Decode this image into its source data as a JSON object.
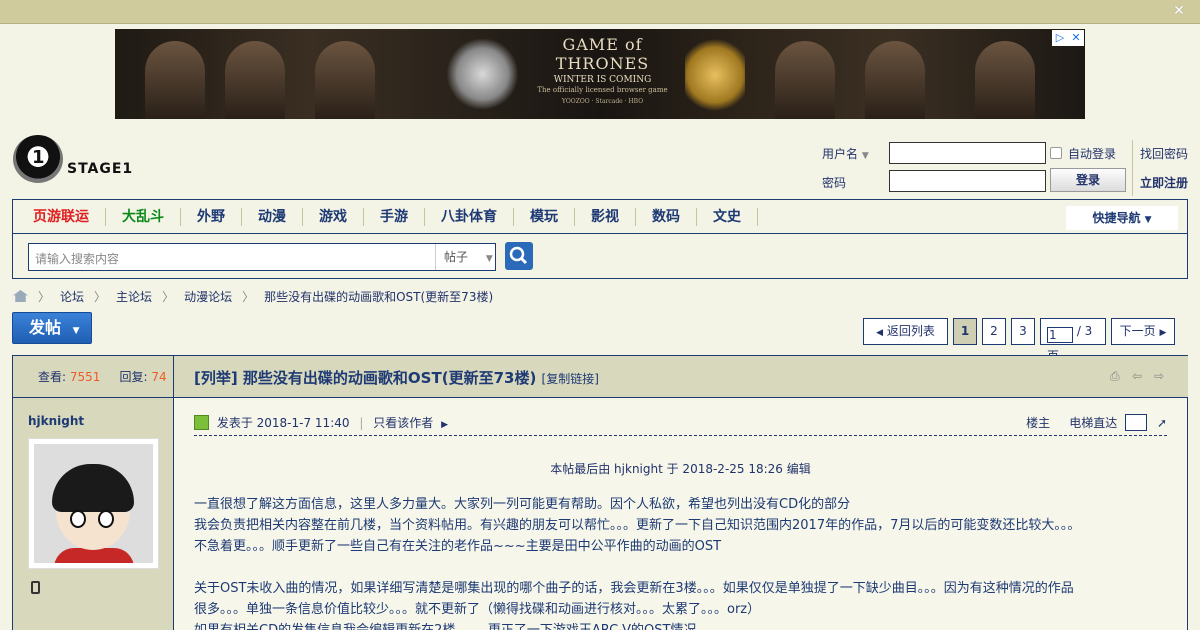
{
  "topbar": {
    "close_icon": "close-icon"
  },
  "ad": {
    "title": "GAME of THRONES",
    "subtitle": "WINTER IS COMING",
    "tagline": "The officially licensed browser game",
    "sponsors": "YOOZOO  ·  Starcade  ·  HBO",
    "adchoices": [
      "▷",
      "✕"
    ]
  },
  "site": {
    "name": "STAGE1",
    "logo_digit": "1"
  },
  "login": {
    "username_label": "用户名",
    "password_label": "密码",
    "auto_login": "自动登录",
    "login_button": "登录",
    "forgot_password": "找回密码",
    "register": "立即注册"
  },
  "nav": {
    "items": [
      "页游联运",
      "大乱斗",
      "外野",
      "动漫",
      "游戏",
      "手游",
      "八卦体育",
      "模玩",
      "影视",
      "数码",
      "文史"
    ],
    "quick_nav": "快捷导航",
    "search_placeholder": "请输入搜索内容",
    "search_type": "帖子"
  },
  "breadcrumb": [
    "论坛",
    "主论坛",
    "动漫论坛",
    "那些没有出碟的动画歌和OST(更新至73楼)"
  ],
  "toolbar": {
    "post_button": "发帖"
  },
  "pager": {
    "back": "返回列表",
    "pages": [
      "1",
      "2",
      "3"
    ],
    "current": "1",
    "total": "/ 3 页",
    "next": "下一页"
  },
  "thread": {
    "views_label": "查看:",
    "views": "7551",
    "replies_label": "回复:",
    "replies": "74",
    "title": "[列举] 那些没有出碟的动画歌和OST(更新至73楼)",
    "copy_link": "[复制链接]",
    "author": "hjknight",
    "posted": "发表于 2018-1-7 11:40",
    "only_author": "只看该作者",
    "floor_label": "楼主",
    "jump_label": "电梯直达",
    "edited": "本帖最后由 hjknight 于 2018-2-25 18:26 编辑",
    "lines": [
      "一直很想了解这方面信息，这里人多力量大。大家列一列可能更有帮助。因个人私欲，希望也列出没有CD化的部分",
      "我会负责把相关内容整在前几楼，当个资料帖用。有兴趣的朋友可以帮忙。。。更新了一下自己知识范围内2017年的作品，7月以后的可能变数还比较大。。。",
      "不急着更。。。顺手更新了一些自己有在关注的老作品~~~主要是田中公平作曲的动画的OST",
      "",
      "关于OST未收入曲的情况，如果详细写清楚是哪集出现的哪个曲子的话，我会更新在3楼。。。如果仅仅是单独提了一下缺少曲目。。。因为有这种情况的作品",
      "很多。。。单独一条信息价值比较少。。。就不更新了（懒得找碟和动画进行核对。。。太累了。。。orz）",
      "如果有相关CD的发售信息我会编辑更新在2楼。。。。更正了一下游戏王ARC-V的OST情况"
    ]
  }
}
